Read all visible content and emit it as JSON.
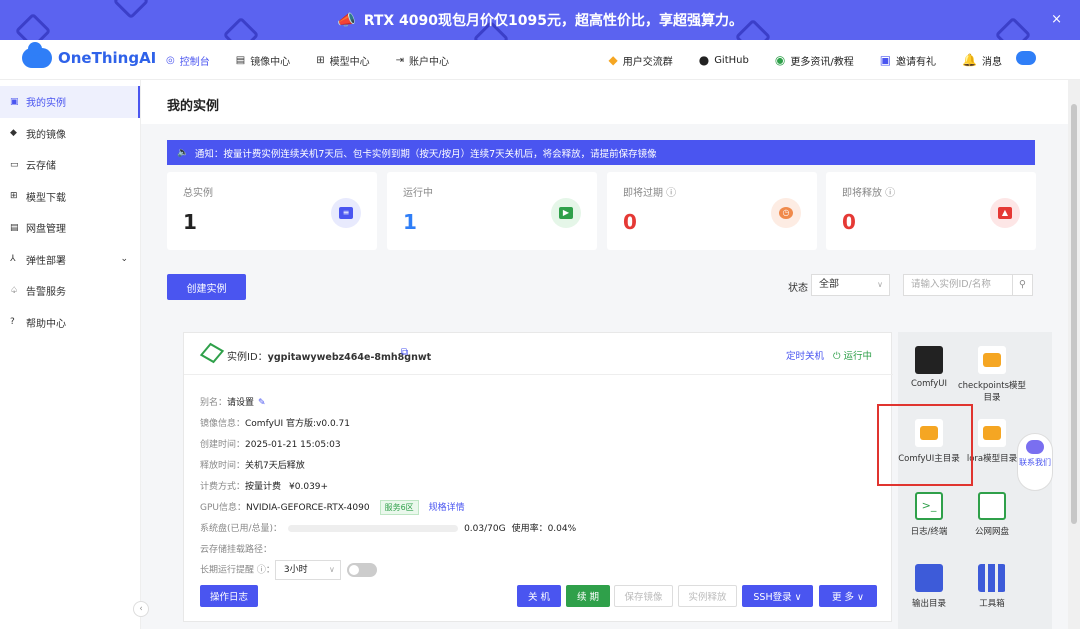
{
  "banner": {
    "text": "RTX 4090现包月价仅1095元，超高性价比，享超强算力。",
    "close": "×"
  },
  "nav": {
    "logo": "OneThingAI",
    "tabs": [
      {
        "icon": "◎",
        "label": "控制台"
      },
      {
        "icon": "▤",
        "label": "镜像中心"
      },
      {
        "icon": "⊞",
        "label": "模型中心"
      },
      {
        "icon": "⇥",
        "label": "账户中心"
      }
    ],
    "right": [
      {
        "icon": "◆",
        "label": "用户交流群"
      },
      {
        "icon": "●",
        "label": "GitHub"
      },
      {
        "icon": "◉",
        "label": "更多资讯/教程"
      },
      {
        "icon": "▣",
        "label": "邀请有礼"
      },
      {
        "icon": "🔔",
        "label": "消息"
      }
    ]
  },
  "sidebar": {
    "items": [
      {
        "icon": "▣",
        "label": "我的实例"
      },
      {
        "icon": "◆",
        "label": "我的镜像"
      },
      {
        "icon": "▭",
        "label": "云存储"
      },
      {
        "icon": "⊞",
        "label": "模型下载"
      },
      {
        "icon": "▤",
        "label": "网盘管理"
      },
      {
        "icon": "⅄",
        "label": "弹性部署",
        "chevron": "⌄"
      },
      {
        "icon": "♤",
        "label": "告警服务"
      },
      {
        "icon": "?",
        "label": "帮助中心"
      }
    ],
    "collapse": "‹"
  },
  "page": {
    "title": "我的实例"
  },
  "notice": {
    "icon": "🔈",
    "text": "通知：按量计费实例连续关机7天后、包卡实例到期（按天/按月）连续7天关机后，将会释放，请提前保存镜像"
  },
  "stats": [
    {
      "label": "总实例",
      "value": "1",
      "color": "#222"
    },
    {
      "label": "运行中",
      "value": "1",
      "color": "#2f7ef7"
    },
    {
      "label": "即将过期 ⓘ",
      "value": "0",
      "color": "#e53935"
    },
    {
      "label": "即将释放 ⓘ",
      "value": "0",
      "color": "#e53935"
    }
  ],
  "toolbar": {
    "create": "创建实例",
    "status_label": "状态",
    "status_value": "全部",
    "search_placeholder": "请输入实例ID/名称"
  },
  "instance": {
    "id_label": "实例ID：",
    "id": "ygpitawywebz464e-8mh8gnwt",
    "schedule": "定时关机",
    "status": "运行中",
    "alias_label": "别名：",
    "alias": "请设置",
    "image_label": "镜像信息：",
    "image": "ComfyUI 官方版:v0.0.71",
    "created_label": "创建时间：",
    "created": "2025-01-21 15:05:03",
    "release_label": "释放时间：",
    "release": "关机7天后释放",
    "billing_label": "计费方式：",
    "billing": "按量计费",
    "price": "¥0.039+",
    "gpu_label": "GPU信息：",
    "gpu": "NVIDIA-GEFORCE-RTX-4090",
    "gpu_tag": "服务6区",
    "gpu_link": "规格详情",
    "disk_label": "系统盘(已用/总量)：",
    "disk_value": "0.03/70G",
    "disk_usage": "使用率：0.04%",
    "disk_fraction": 0.0004,
    "mount_label": "云存储挂载路径：",
    "reminder_label": "长期运行提醒 ⓘ：",
    "reminder_value": "3小时",
    "buttons": {
      "log": "操作日志",
      "shutdown": "关 机",
      "renew": "续 期",
      "save": "保存镜像",
      "release": "实例释放",
      "ssh": "SSH登录 ∨",
      "more": "更 多 ∨"
    }
  },
  "apps": [
    {
      "label": "ComfyUI"
    },
    {
      "label": "checkpoints模型目录"
    },
    {
      "label": "ComfyUI主目录"
    },
    {
      "label": "lora模型目录"
    },
    {
      "label": "日志/终端"
    },
    {
      "label": "公网网盘"
    },
    {
      "label": "输出目录"
    },
    {
      "label": "工具箱"
    }
  ],
  "contact": {
    "label": "联系我们"
  }
}
